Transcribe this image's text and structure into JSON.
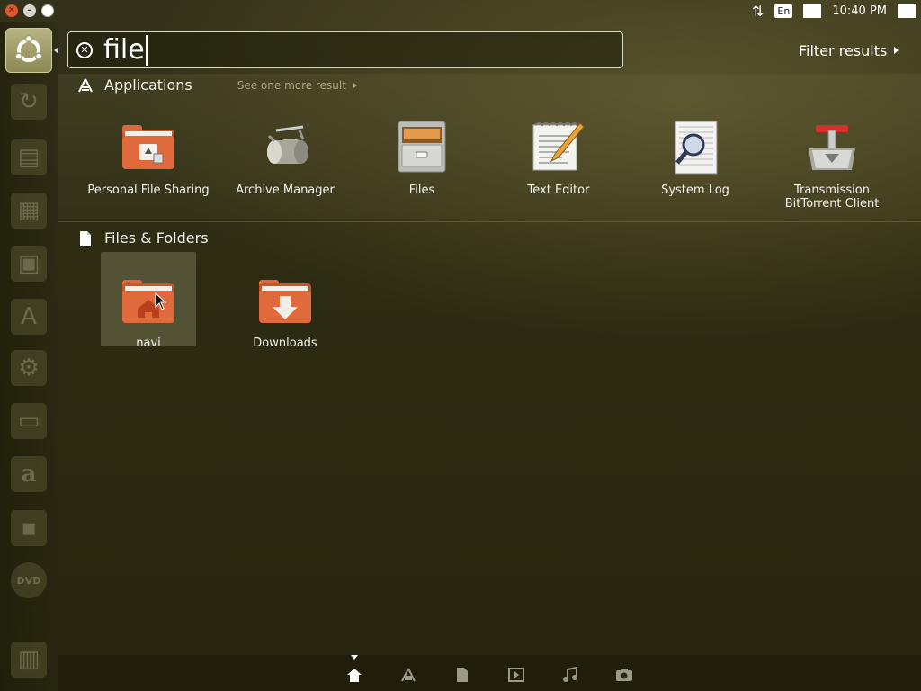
{
  "top_panel": {
    "window_controls": [
      "close",
      "minimize",
      "maximize"
    ],
    "keyboard_layout": "En",
    "clock": "10:40 PM"
  },
  "launcher": {
    "items": [
      {
        "name": "ubuntu-logo-icon"
      },
      {
        "name": "update-icon"
      },
      {
        "name": "writer-document-icon"
      },
      {
        "name": "calc-spreadsheet-icon"
      },
      {
        "name": "impress-presentation-icon"
      },
      {
        "name": "software-center-icon"
      },
      {
        "name": "settings-gear-icon"
      },
      {
        "name": "drawer-icon"
      },
      {
        "name": "amazon-icon"
      },
      {
        "name": "floppy-icon"
      },
      {
        "name": "dvd-icon"
      },
      {
        "name": "trash-icon"
      }
    ],
    "amazon_letter": "a",
    "dvd_label": "DVD"
  },
  "search": {
    "query": "file"
  },
  "filter": {
    "label": "Filter results"
  },
  "applications": {
    "header": "Applications",
    "see_more": "See one more result",
    "items": [
      {
        "label": "Personal File Sharing",
        "icon": "folder-share-icon"
      },
      {
        "label": "Archive Manager",
        "icon": "archive-manager-icon"
      },
      {
        "label": "Files",
        "icon": "file-cabinet-icon"
      },
      {
        "label": "Text Editor",
        "icon": "text-editor-icon"
      },
      {
        "label": "System Log",
        "icon": "system-log-icon"
      },
      {
        "label_line1": "Transmission",
        "label_line2": "BitTorrent Client",
        "icon": "transmission-icon"
      }
    ]
  },
  "files_folders": {
    "header": "Files & Folders",
    "items": [
      {
        "label": "navi",
        "icon": "home-folder-icon",
        "selected": true
      },
      {
        "label": "Downloads",
        "icon": "downloads-folder-icon"
      }
    ]
  },
  "lenses": [
    {
      "name": "home-lens-icon",
      "active": true
    },
    {
      "name": "applications-lens-icon"
    },
    {
      "name": "files-lens-icon"
    },
    {
      "name": "video-lens-icon"
    },
    {
      "name": "music-lens-icon"
    },
    {
      "name": "photo-lens-icon"
    }
  ],
  "colors": {
    "dash_background": "#2b2a10",
    "folder_orange": "#e0663a",
    "text": "#f2f2ea"
  }
}
